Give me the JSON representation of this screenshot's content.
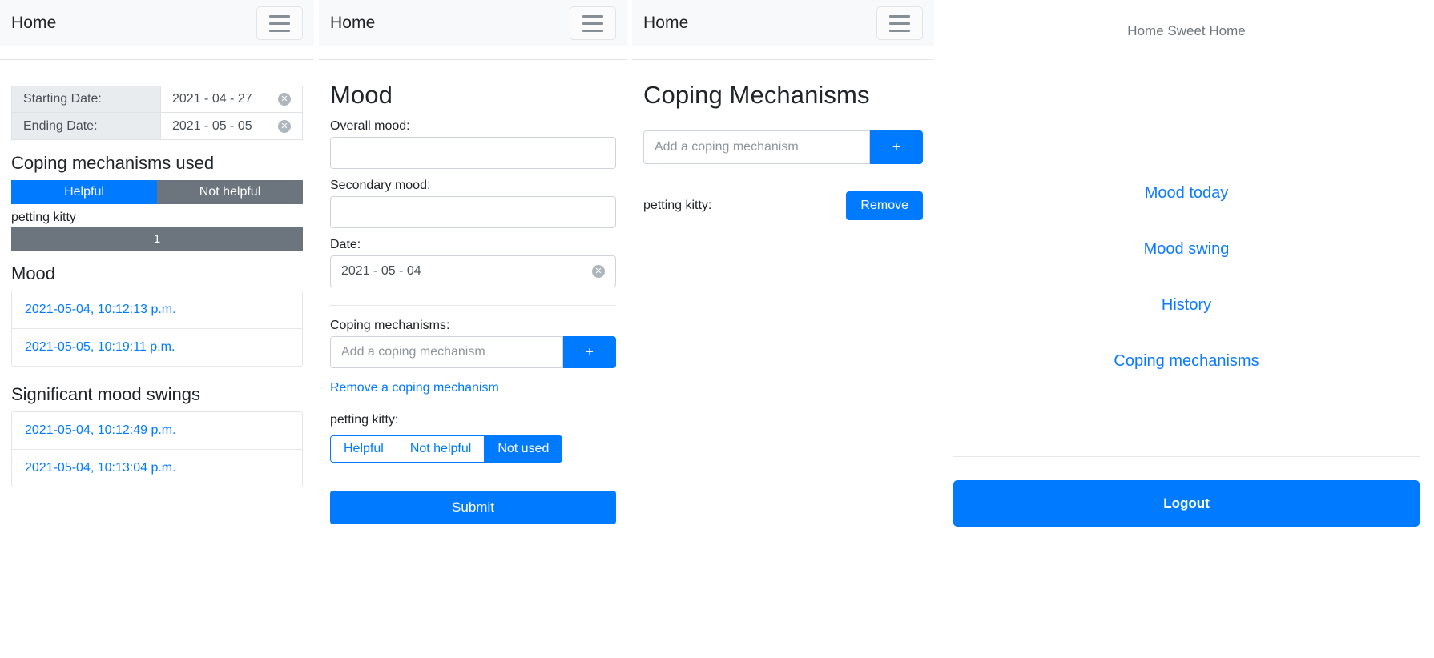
{
  "panel_history": {
    "navbar": {
      "brand": "Home",
      "toggler_icon": "hamburger-menu-icon"
    },
    "dates": [
      {
        "label": "Starting Date:",
        "value": "2021 - 04 - 27",
        "clear_icon": "clear-circle-icon"
      },
      {
        "label": "Ending Date:",
        "value": "2021 - 05 - 05",
        "clear_icon": "clear-circle-icon"
      }
    ],
    "coping_section_title": "Coping mechanisms used",
    "legend": {
      "helpful": "Helpful",
      "not_helpful": "Not helpful"
    },
    "mechanism": {
      "name": "petting kitty",
      "count": "1"
    },
    "mood_title": "Mood",
    "mood_entries": [
      "2021-05-04, 10:12:13 p.m.",
      "2021-05-05, 10:19:11 p.m."
    ],
    "swings_title": "Significant mood swings",
    "swing_entries": [
      "2021-05-04, 10:12:49 p.m.",
      "2021-05-04, 10:13:04 p.m."
    ]
  },
  "panel_mood": {
    "navbar": {
      "brand": "Home",
      "toggler_icon": "hamburger-menu-icon"
    },
    "title": "Mood",
    "overall_label": "Overall mood:",
    "overall_value": "",
    "secondary_label": "Secondary mood:",
    "secondary_value": "",
    "date_label": "Date:",
    "date_value": "2021 - 05 - 04",
    "date_clear_icon": "clear-circle-icon",
    "coping_label": "Coping mechanisms:",
    "coping_placeholder": "Add a coping mechanism",
    "add_button": "+",
    "remove_link": "Remove a coping mechanism",
    "mechanism_label": "petting kitty:",
    "usage_options": [
      "Helpful",
      "Not helpful",
      "Not used"
    ],
    "usage_selected": "Not used",
    "submit_label": "Submit"
  },
  "panel_coping": {
    "navbar": {
      "brand": "Home",
      "toggler_icon": "hamburger-menu-icon"
    },
    "title": "Coping Mechanisms",
    "add_placeholder": "Add a coping mechanism",
    "add_button": "+",
    "items": [
      {
        "label": "petting kitty:",
        "remove_label": "Remove"
      }
    ]
  },
  "panel_nav": {
    "brand": "Home Sweet Home",
    "links": [
      "Mood today",
      "Mood swing",
      "History",
      "Coping mechanisms"
    ],
    "logout_label": "Logout"
  },
  "colors": {
    "primary": "#007bff",
    "secondary": "#6c757d",
    "link": "#0d7bff",
    "navbar_bg": "#f8f9fa",
    "table_head_bg": "#e9ecef"
  }
}
